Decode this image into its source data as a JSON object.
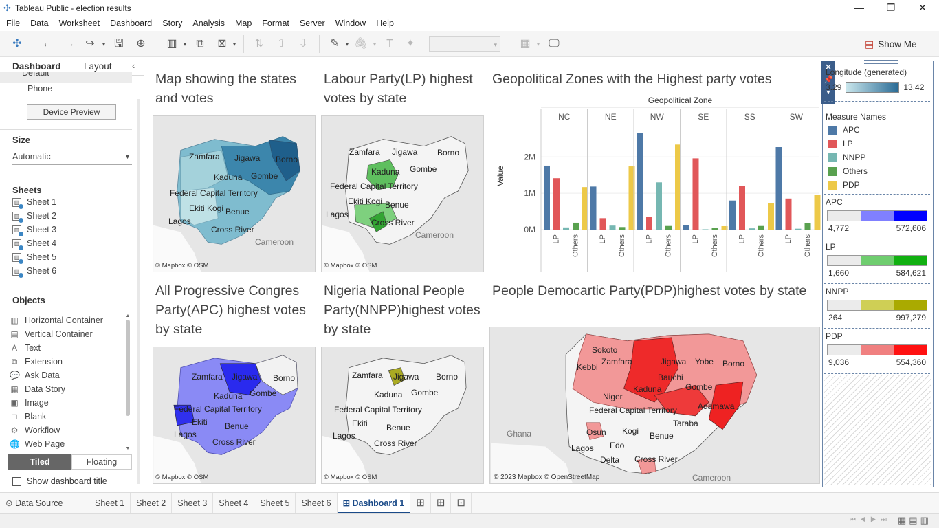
{
  "window": {
    "title": "Tableau Public - election results",
    "minimize": "—",
    "maximize": "❐",
    "close": "✕"
  },
  "menu": [
    "File",
    "Data",
    "Worksheet",
    "Dashboard",
    "Story",
    "Analysis",
    "Map",
    "Format",
    "Server",
    "Window",
    "Help"
  ],
  "toolbar": {
    "show_me": "Show Me"
  },
  "left": {
    "tabs": [
      "Dashboard",
      "Layout"
    ],
    "devices": [
      "Default",
      "Phone"
    ],
    "device_preview": "Device Preview",
    "size_head": "Size",
    "size_value": "Automatic",
    "sheets_head": "Sheets",
    "sheets": [
      "Sheet 1",
      "Sheet 2",
      "Sheet 3",
      "Sheet 4",
      "Sheet 5",
      "Sheet 6"
    ],
    "objects_head": "Objects",
    "objects": [
      {
        "label": "Horizontal Container",
        "icon": "horizontal-container-icon",
        "glyph": "▥"
      },
      {
        "label": "Vertical Container",
        "icon": "vertical-container-icon",
        "glyph": "▤"
      },
      {
        "label": "Text",
        "icon": "text-icon",
        "glyph": "A"
      },
      {
        "label": "Extension",
        "icon": "extension-icon",
        "glyph": "⧉"
      },
      {
        "label": "Ask Data",
        "icon": "ask-data-icon",
        "glyph": "💬"
      },
      {
        "label": "Data Story",
        "icon": "data-story-icon",
        "glyph": "▦"
      },
      {
        "label": "Image",
        "icon": "image-icon",
        "glyph": "▣"
      },
      {
        "label": "Blank",
        "icon": "blank-icon",
        "glyph": "□"
      },
      {
        "label": "Workflow",
        "icon": "workflow-icon",
        "glyph": "⚙"
      },
      {
        "label": "Web Page",
        "icon": "web-page-icon",
        "glyph": "🌐"
      }
    ],
    "tiled": "Tiled",
    "floating": "Floating",
    "show_title": "Show dashboard title"
  },
  "dashboard": {
    "t1": "Map showing the states and votes",
    "t2": "Labour Party(LP) highest votes by state",
    "t3": "Geopolitical Zones with the Highest party votes",
    "t4": "All Progressive Congres Party(APC) highest votes by state",
    "t5": "Nigeria National People Party(NNPP)highest votes by state",
    "t6": "People Democartic Party(PDP)highest votes by state",
    "credit_small": "© Mapbox © OSM",
    "credit_big": "© 2023 Mapbox © OpenStreetMap",
    "cameroon": "Cameroon",
    "ghana": "Ghana",
    "labels": {
      "zamfara": "Zamfara",
      "jigawa": "Jigawa",
      "borno": "Borno",
      "kaduna": "Kaduna",
      "gombe": "Gombe",
      "fct": "Federal Capital Territory",
      "ekiti": "Ekiti",
      "kogi": "Kogi",
      "benue": "Benue",
      "lagos": "Lagos",
      "cross_river": "Cross River",
      "sokoto": "Sokoto",
      "kebbi": "Kebbi",
      "yobe": "Yobe",
      "bauchi": "Bauchi",
      "niger": "Niger",
      "taraba": "Taraba",
      "adamawa": "Adamawa",
      "osun": "Osun",
      "edo": "Edo",
      "delta": "Delta"
    }
  },
  "chart_data": {
    "type": "bar",
    "title": "Geopolitical Zones with the Highest party votes",
    "header": "Geopolitical Zone",
    "ylabel": "Value",
    "yticks": [
      "2M",
      "1M",
      "0M"
    ],
    "ylim": [
      0,
      2800000
    ],
    "zones": [
      "NC",
      "NE",
      "NW",
      "SE",
      "SS",
      "SW"
    ],
    "xtick_labels": [
      "LP",
      "Others"
    ],
    "parties": [
      "APC",
      "LP",
      "NNPP",
      "Others",
      "PDP"
    ],
    "colors": [
      "#4e79a7",
      "#e15759",
      "#76b7b2",
      "#59a14f",
      "#edc948"
    ],
    "series": [
      {
        "name": "APC",
        "values": [
          1760000,
          1185000,
          2655000,
          127000,
          800000,
          2270000
        ]
      },
      {
        "name": "LP",
        "values": [
          1415000,
          315000,
          350000,
          1960000,
          1210000,
          855000
        ]
      },
      {
        "name": "NNPP",
        "values": [
          60000,
          110000,
          1300000,
          10000,
          35000,
          25000
        ]
      },
      {
        "name": "Others",
        "values": [
          190000,
          70000,
          100000,
          40000,
          100000,
          175000
        ]
      },
      {
        "name": "PDP",
        "values": [
          1170000,
          1740000,
          2340000,
          95000,
          730000,
          960000
        ]
      }
    ]
  },
  "legends": {
    "longitude_title": "Longitude (generated)",
    "lon_min": "3.29",
    "lon_max": "13.42",
    "measure_title": "Measure Names",
    "measures": [
      "APC",
      "LP",
      "NNPP",
      "Others",
      "PDP"
    ],
    "measure_colors": [
      "#4e79a7",
      "#e15759",
      "#76b7b2",
      "#59a14f",
      "#edc948"
    ],
    "ranges": [
      {
        "name": "APC",
        "min": "4,772",
        "max": "572,606",
        "colors": [
          "#ebebeb",
          "#8080ff",
          "#0000ff"
        ]
      },
      {
        "name": "LP",
        "min": "1,660",
        "max": "584,621",
        "colors": [
          "#ebebeb",
          "#6fcd6f",
          "#11b011"
        ]
      },
      {
        "name": "NNPP",
        "min": "264",
        "max": "997,279",
        "colors": [
          "#ebebeb",
          "#cfcf55",
          "#aaaa00"
        ]
      },
      {
        "name": "PDP",
        "min": "9,036",
        "max": "554,360",
        "colors": [
          "#ebebeb",
          "#f08080",
          "#ff1111"
        ]
      }
    ]
  },
  "status": {
    "data_source": "Data Source",
    "sheets": [
      "Sheet 1",
      "Sheet 2",
      "Sheet 3",
      "Sheet 4",
      "Sheet 5",
      "Sheet 6"
    ],
    "dashboard_tab": "Dashboard 1"
  }
}
